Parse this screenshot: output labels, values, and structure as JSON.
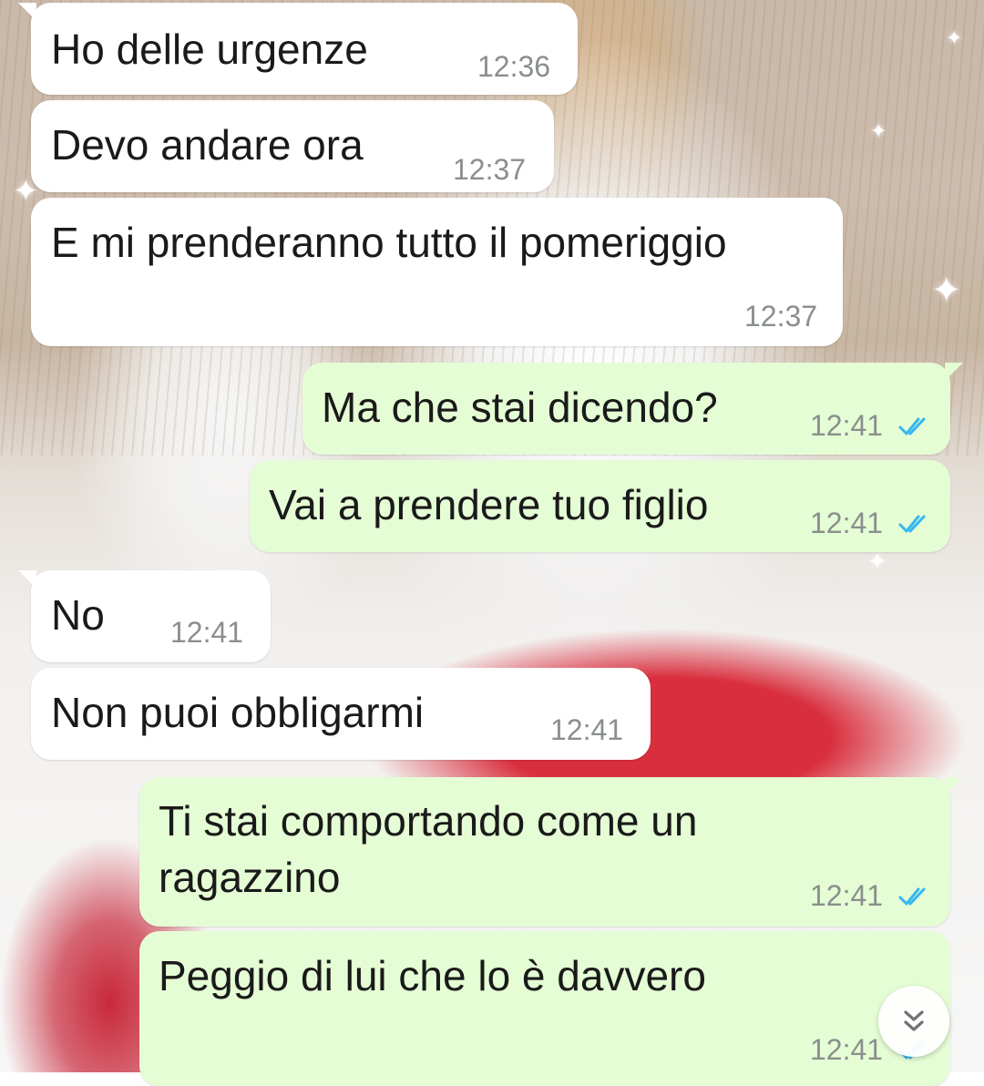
{
  "colors": {
    "incoming_bubble": "#ffffff",
    "outgoing_bubble": "#e5fdd5",
    "read_ticks": "#34b7f1",
    "timestamp": "#8a8f8c",
    "text": "#1a1a1a"
  },
  "messages": [
    {
      "direction": "incoming",
      "text": "Ho delle urgenze",
      "time": "12:36"
    },
    {
      "direction": "incoming",
      "text": "Devo andare ora",
      "time": "12:37"
    },
    {
      "direction": "incoming",
      "text": "E mi prenderanno tutto il pomeriggio",
      "time": "12:37"
    },
    {
      "direction": "outgoing",
      "text": "Ma che stai dicendo?",
      "time": "12:41",
      "status": "read-ticks-icon"
    },
    {
      "direction": "outgoing",
      "text": "Vai a prendere tuo figlio",
      "time": "12:41",
      "status": "read-ticks-icon"
    },
    {
      "direction": "incoming",
      "text": "No",
      "time": "12:41"
    },
    {
      "direction": "incoming",
      "text": "Non puoi obbligarmi",
      "time": "12:41"
    },
    {
      "direction": "outgoing",
      "text_lines": [
        "Ti stai comportando come un",
        "ragazzino"
      ],
      "time": "12:41",
      "status": "read-ticks-icon"
    },
    {
      "direction": "outgoing",
      "text": "Peggio di lui che lo è davvero",
      "time": "12:41",
      "status": "read-ticks-icon"
    }
  ],
  "scroll_button": {
    "icon": "double-chevron-down-icon"
  }
}
